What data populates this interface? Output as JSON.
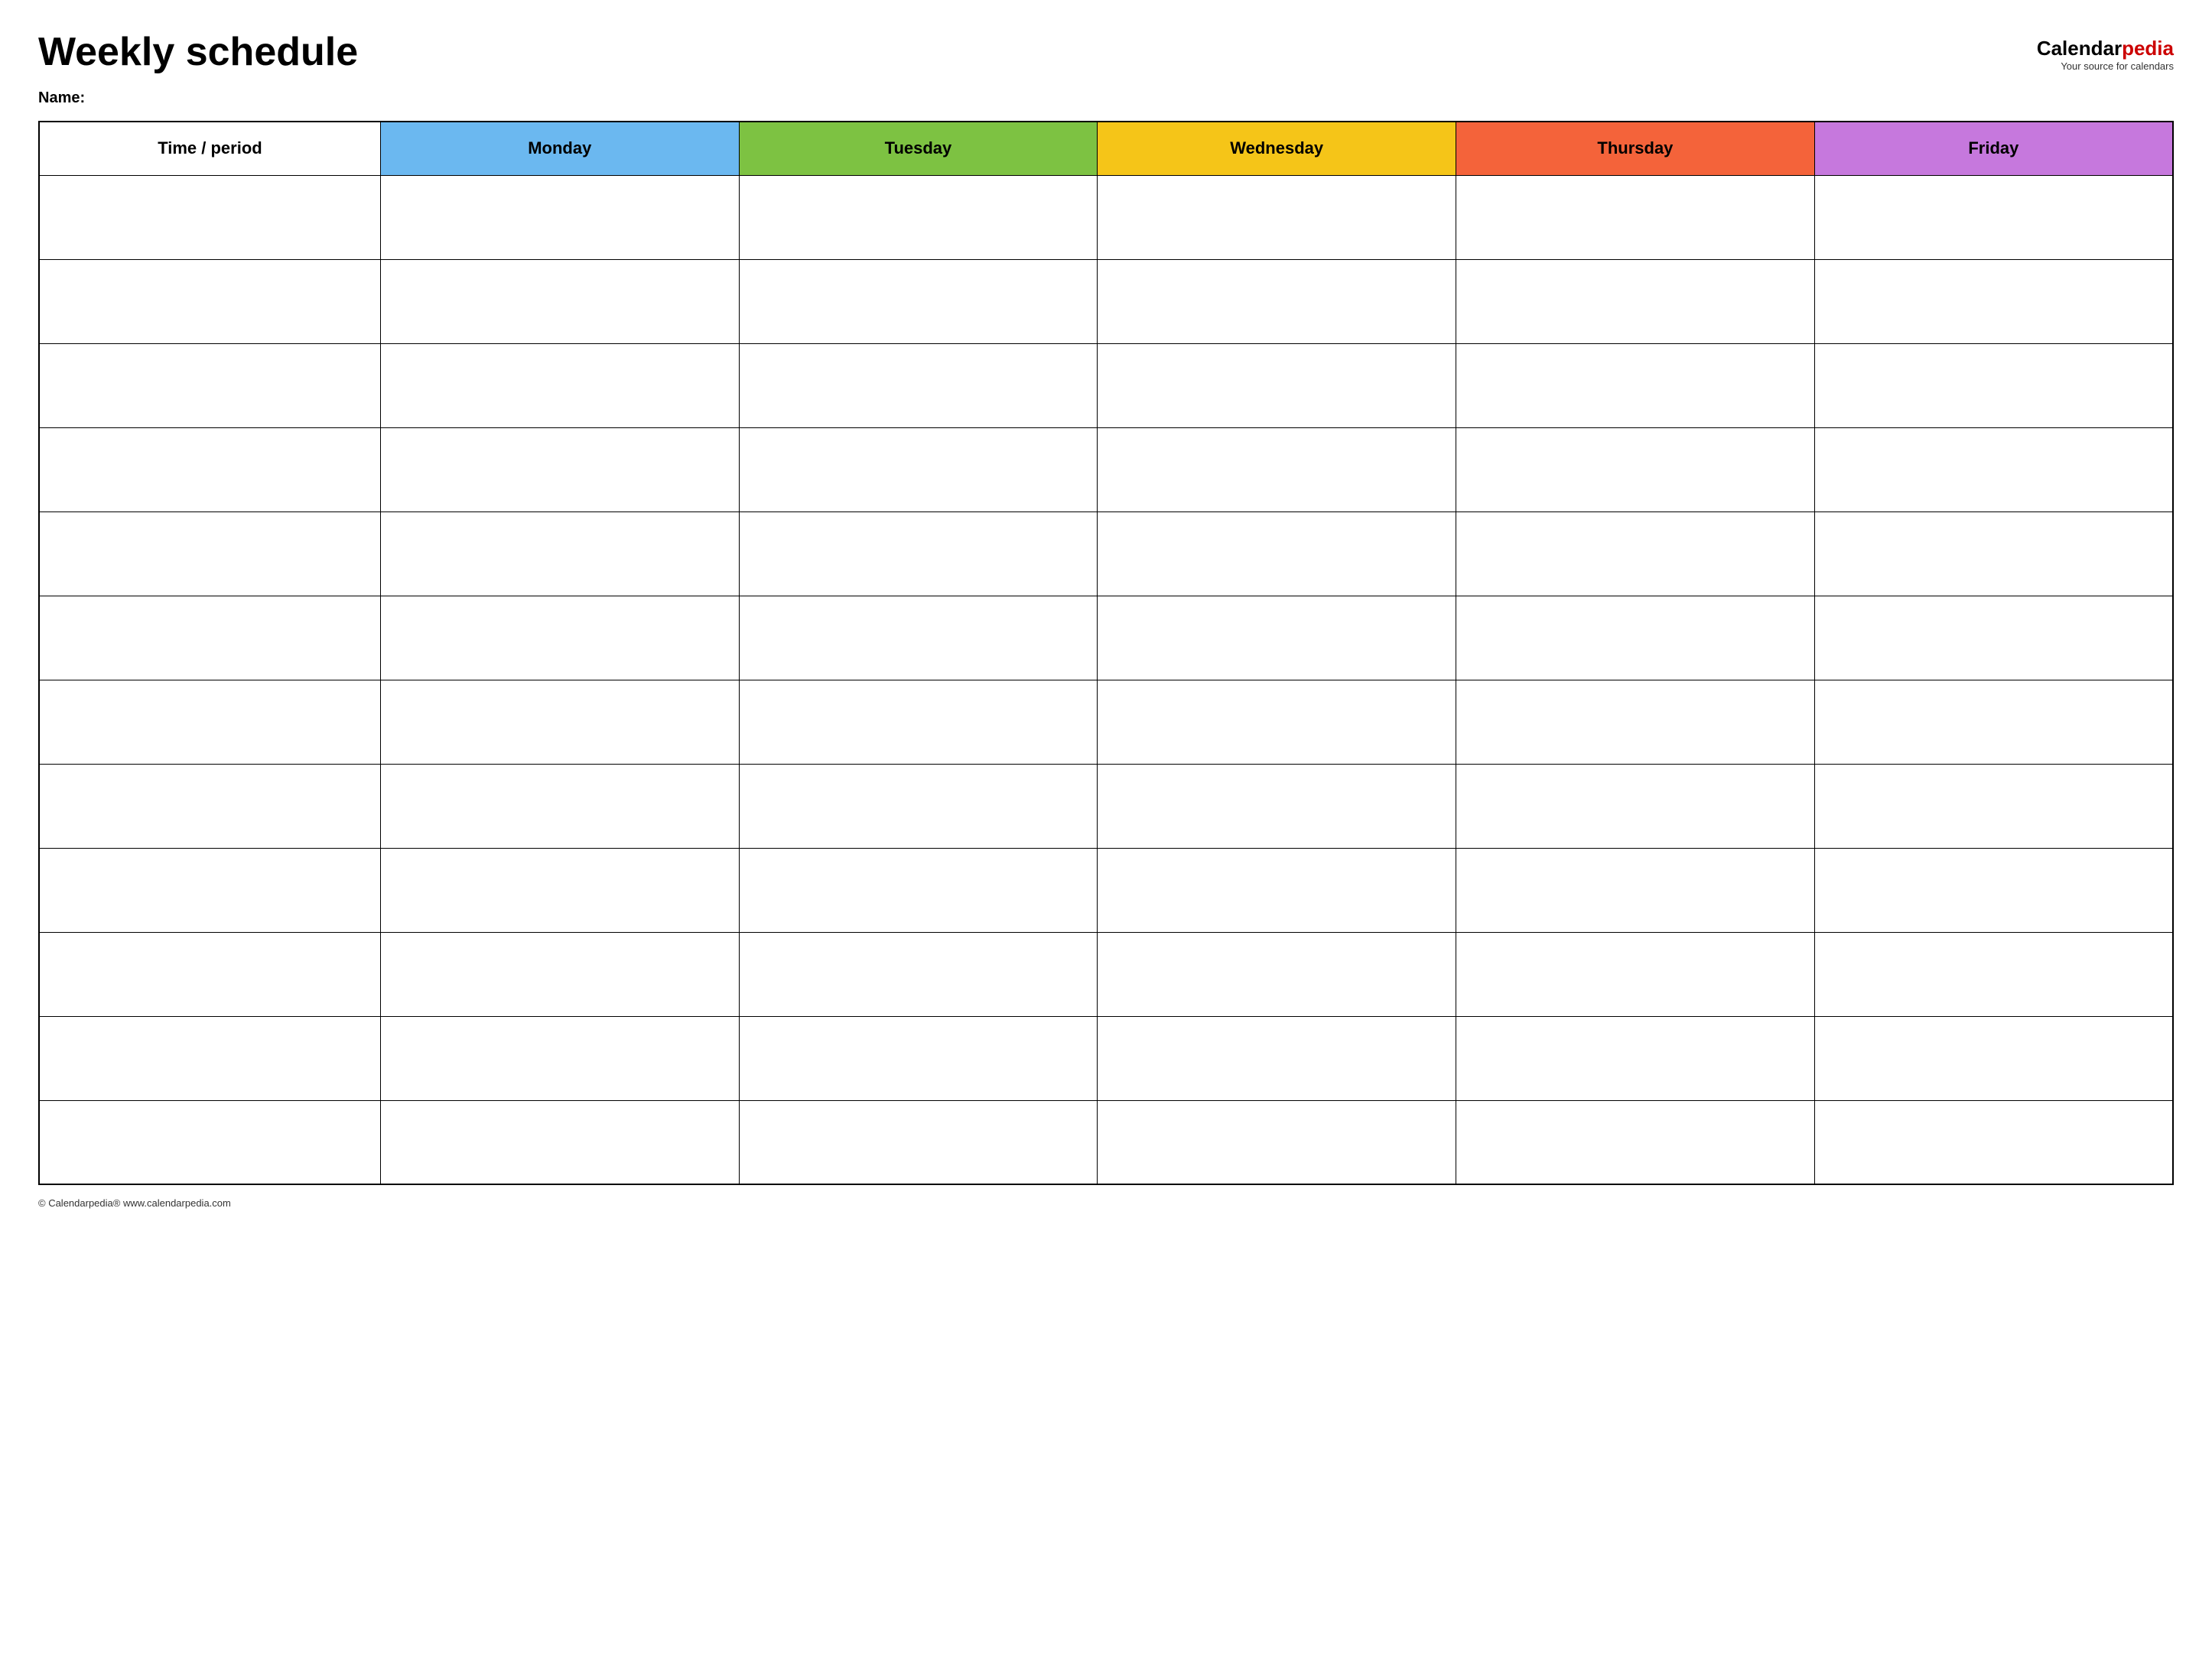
{
  "header": {
    "title": "Weekly schedule",
    "logo_calendar": "Calendar",
    "logo_pedia": "pedia",
    "logo_subtitle": "Your source for calendars"
  },
  "name_label": "Name:",
  "table": {
    "columns": [
      {
        "key": "time",
        "label": "Time / period",
        "color": "#ffffff",
        "text_color": "#000000"
      },
      {
        "key": "monday",
        "label": "Monday",
        "color": "#6bb8f0",
        "text_color": "#000000"
      },
      {
        "key": "tuesday",
        "label": "Tuesday",
        "color": "#7dc242",
        "text_color": "#000000"
      },
      {
        "key": "wednesday",
        "label": "Wednesday",
        "color": "#f5c518",
        "text_color": "#000000"
      },
      {
        "key": "thursday",
        "label": "Thursday",
        "color": "#f4633a",
        "text_color": "#000000"
      },
      {
        "key": "friday",
        "label": "Friday",
        "color": "#c678dd",
        "text_color": "#000000"
      }
    ],
    "row_count": 12
  },
  "footer": {
    "copyright": "© Calendarpedia®  www.calendarpedia.com"
  }
}
